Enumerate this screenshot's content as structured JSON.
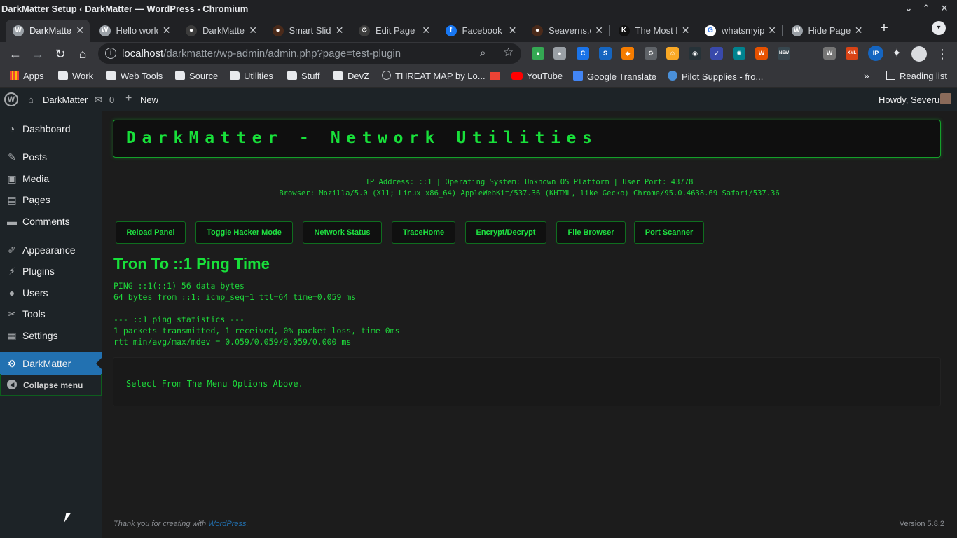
{
  "window": {
    "title": "DarkMatter Setup ‹ DarkMatter — WordPress - Chromium",
    "controls": [
      "⌄",
      "⌃",
      "✕"
    ]
  },
  "tabs": [
    {
      "label": "DarkMatter",
      "icon": "wordpress-icon",
      "active": true
    },
    {
      "label": "Hello world",
      "icon": "wordpress-icon"
    },
    {
      "label": "DarkMatter",
      "icon": "github-icon"
    },
    {
      "label": "Smart Slider",
      "icon": "dark-avatar-icon"
    },
    {
      "label": "Edit Page",
      "icon": "gear-outline-icon"
    },
    {
      "label": "Facebook",
      "icon": "facebook-icon"
    },
    {
      "label": "Seaverns.c",
      "icon": "dark-avatar-icon"
    },
    {
      "label": "The Most F",
      "icon": "k-logo-icon"
    },
    {
      "label": "whatsmyip",
      "icon": "google-icon"
    },
    {
      "label": "Hide Page",
      "icon": "wordpress-icon"
    }
  ],
  "toolbar": {
    "url_host": "localhost",
    "url_path": "/darkmatter/wp-admin/admin.php?page=test-plugin",
    "extensions": [
      {
        "name": "google-drive-icon",
        "color": "#34a853",
        "glyph": "▲"
      },
      {
        "name": "extension-cluster-icon",
        "color": "#9aa0a6",
        "glyph": "●"
      },
      {
        "name": "shield-extension-icon",
        "color": "#1a73e8",
        "glyph": "C"
      },
      {
        "name": "s-extension-icon",
        "color": "#1565c0",
        "glyph": "S"
      },
      {
        "name": "orange-extension-icon",
        "color": "#f57c00",
        "glyph": "◆"
      },
      {
        "name": "gear-extension-icon",
        "color": "#5f6368",
        "glyph": "⚙"
      },
      {
        "name": "emoji-extension-icon",
        "color": "#f9a825",
        "glyph": "☺"
      },
      {
        "name": "dark-extension-icon",
        "color": "#263238",
        "glyph": "◉"
      },
      {
        "name": "checklist-extension-icon",
        "color": "#3949ab",
        "glyph": "✓"
      },
      {
        "name": "react-extension-icon",
        "color": "#00838f",
        "glyph": "✺"
      },
      {
        "name": "w-orange-extension-icon",
        "color": "#e65100",
        "glyph": "W"
      },
      {
        "name": "new-extension-icon",
        "color": "#37474f",
        "glyph": "NEW"
      },
      {
        "name": "w-grey-extension-icon",
        "color": "#757575",
        "glyph": "W"
      },
      {
        "name": "xml-extension-icon",
        "color": "#d84315",
        "glyph": "XML"
      },
      {
        "name": "ip-extension-icon",
        "color": "#1565c0",
        "glyph": "IP"
      }
    ]
  },
  "bookmarks": [
    {
      "label": "Apps",
      "icon": "apps-grid-icon"
    },
    {
      "label": "Work",
      "icon": "folder-icon"
    },
    {
      "label": "Web Tools",
      "icon": "folder-icon"
    },
    {
      "label": "Source",
      "icon": "folder-icon"
    },
    {
      "label": "Utilities",
      "icon": "folder-icon"
    },
    {
      "label": "Stuff",
      "icon": "folder-icon"
    },
    {
      "label": "DevZ",
      "icon": "folder-icon"
    },
    {
      "label": "THREAT MAP by Lo...",
      "icon": "threat-map-icon"
    },
    {
      "label": "",
      "icon": "gmail-icon"
    },
    {
      "label": "YouTube",
      "icon": "youtube-icon"
    },
    {
      "label": "Google Translate",
      "icon": "translate-icon"
    },
    {
      "label": "Pilot Supplies - fro...",
      "icon": "pilot-icon"
    }
  ],
  "reading_list": "Reading list",
  "adminbar": {
    "site": "DarkMatter",
    "comments": "0",
    "new": "New",
    "howdy": "Howdy, Severus"
  },
  "sidebar": [
    {
      "label": "Dashboard",
      "icon": "dashboard-icon"
    },
    {
      "label": "Posts",
      "icon": "pin-icon"
    },
    {
      "label": "Media",
      "icon": "media-icon"
    },
    {
      "label": "Pages",
      "icon": "pages-icon"
    },
    {
      "label": "Comments",
      "icon": "comment-icon"
    },
    {
      "label": "Appearance",
      "icon": "brush-icon"
    },
    {
      "label": "Plugins",
      "icon": "plugin-icon"
    },
    {
      "label": "Users",
      "icon": "user-icon"
    },
    {
      "label": "Tools",
      "icon": "wrench-icon"
    },
    {
      "label": "Settings",
      "icon": "settings-icon"
    },
    {
      "label": "DarkMatter",
      "icon": "gear-icon",
      "current": true
    }
  ],
  "collapse_menu": "Collapse menu",
  "main": {
    "heading": "DarkMatter - Network Utilities",
    "sysinfo_line1": "IP Address: ::1 | Operating System: Unknown OS Platform | User Port: 43778",
    "sysinfo_line2": "Browser: Mozilla/5.0 (X11; Linux x86_64) AppleWebKit/537.36 (KHTML, like Gecko) Chrome/95.0.4638.69 Safari/537.36",
    "buttons": [
      "Reload Panel",
      "Toggle Hacker Mode",
      "Network Status",
      "TraceHome",
      "Encrypt/Decrypt",
      "File Browser",
      "Port Scanner"
    ],
    "ping_title": "Tron To ::1 Ping Time",
    "ping_output": [
      "PING ::1(::1) 56 data bytes",
      "64 bytes from ::1: icmp_seq=1 ttl=64 time=0.059 ms",
      "",
      "--- ::1 ping statistics ---",
      "1 packets transmitted, 1 received, 0% packet loss, time 0ms",
      "rtt min/avg/max/mdev = 0.059/0.059/0.059/0.000 ms"
    ],
    "output_message": "Select From The Menu Options Above."
  },
  "footer": {
    "thanks_prefix": "Thank you for creating with ",
    "thanks_link": "WordPress",
    "thanks_suffix": ".",
    "version": "Version 5.8.2"
  },
  "colors": {
    "accent_green": "#18e03a",
    "wp_blue": "#2271b1",
    "admin_dark": "#1d2327"
  }
}
